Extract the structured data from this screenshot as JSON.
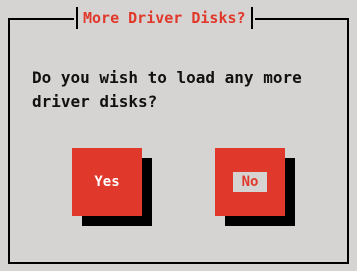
{
  "dialog": {
    "title": "More Driver Disks?",
    "message": "Do you wish to load any more\ndriver disks?"
  },
  "buttons": {
    "yes_label": "Yes",
    "no_label": "No"
  },
  "colors": {
    "background": "#d6d4d2",
    "accent": "#e0382b",
    "shadow": "#000000",
    "text": "#111111"
  }
}
